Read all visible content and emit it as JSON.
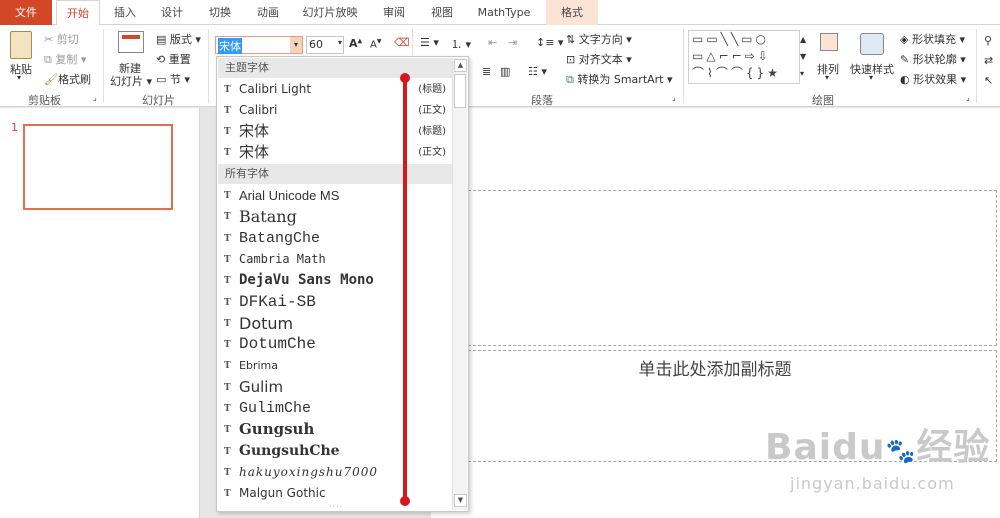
{
  "tabs": [
    "文件",
    "开始",
    "插入",
    "设计",
    "切换",
    "动画",
    "幻灯片放映",
    "审阅",
    "视图",
    "MathType",
    "格式"
  ],
  "clipboard": {
    "paste": "粘贴",
    "cut": "剪切",
    "copy": "复制",
    "format_painter": "格式刷",
    "group": "剪贴板"
  },
  "slides": {
    "new_slide_1": "新建",
    "new_slide_2": "幻灯片",
    "layout": "版式",
    "reset": "重置",
    "section": "节",
    "group": "幻灯片"
  },
  "font": {
    "name": "宋体",
    "size": "60"
  },
  "paragraph": {
    "text_direction": "文字方向",
    "align_text": "对齐文本",
    "smartart": "转换为 SmartArt",
    "group": "段落"
  },
  "drawing": {
    "arrange": "排列",
    "quick_styles": "快速样式",
    "shape_fill": "形状填充",
    "shape_outline": "形状轮廓",
    "shape_effects": "形状效果",
    "group": "绘图"
  },
  "slide_number": "1",
  "subtitle_placeholder": "单击此处添加副标题",
  "dropdown": {
    "theme_header": "主题字体",
    "theme_fonts": [
      {
        "name": "Calibri Light",
        "tag": "(标题)"
      },
      {
        "name": "Calibri",
        "tag": "(正文)"
      },
      {
        "name": "宋体",
        "tag": "(标题)"
      },
      {
        "name": "宋体",
        "tag": "(正文)"
      }
    ],
    "all_header": "所有字体",
    "all_fonts": [
      "Arial Unicode MS",
      "Batang",
      "BatangChe",
      "Cambria Math",
      "DejaVu Sans Mono",
      "DFKai-SB",
      "Dotum",
      "DotumChe",
      "Ebrima",
      "Gulim",
      "GulimChe",
      "Gungsuh",
      "GungsuhChe",
      "hakuyoxingshu7000",
      "Malgun Gothic"
    ]
  },
  "watermark": {
    "brand": "Baidu",
    "brand_cn": "经验",
    "url": "jingyan.baidu.com"
  },
  "colors": {
    "accent": "#d24726",
    "annotation": "#d8161e"
  }
}
